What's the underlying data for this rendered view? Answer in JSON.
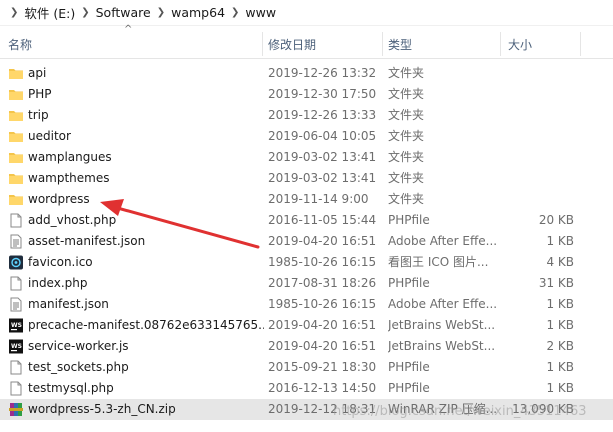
{
  "breadcrumb": [
    "软件 (E:)",
    "Software",
    "wamp64",
    "www"
  ],
  "columns": {
    "name": "名称",
    "date": "修改日期",
    "type": "类型",
    "size": "大小"
  },
  "files": [
    {
      "name": "api",
      "date": "2019-12-26 13:32",
      "type": "文件夹",
      "size": "",
      "icon": "folder-icon"
    },
    {
      "name": "PHP",
      "date": "2019-12-30 17:50",
      "type": "文件夹",
      "size": "",
      "icon": "folder-icon"
    },
    {
      "name": "trip",
      "date": "2019-12-26 13:33",
      "type": "文件夹",
      "size": "",
      "icon": "folder-icon"
    },
    {
      "name": "ueditor",
      "date": "2019-06-04 10:05",
      "type": "文件夹",
      "size": "",
      "icon": "folder-icon"
    },
    {
      "name": "wamplangues",
      "date": "2019-03-02 13:41",
      "type": "文件夹",
      "size": "",
      "icon": "folder-icon"
    },
    {
      "name": "wampthemes",
      "date": "2019-03-02 13:41",
      "type": "文件夹",
      "size": "",
      "icon": "folder-icon"
    },
    {
      "name": "wordpress",
      "date": "2019-11-14 9:00",
      "type": "文件夹",
      "size": "",
      "icon": "folder-icon"
    },
    {
      "name": "add_vhost.php",
      "date": "2016-11-05 15:44",
      "type": "PHPfile",
      "size": "20 KB",
      "icon": "file-icon"
    },
    {
      "name": "asset-manifest.json",
      "date": "2019-04-20 16:51",
      "type": "Adobe After Effe...",
      "size": "1 KB",
      "icon": "json-file-icon"
    },
    {
      "name": "favicon.ico",
      "date": "1985-10-26 16:15",
      "type": "看图王 ICO 图片...",
      "size": "4 KB",
      "icon": "ico-file-icon"
    },
    {
      "name": "index.php",
      "date": "2017-08-31 18:26",
      "type": "PHPfile",
      "size": "31 KB",
      "icon": "file-icon"
    },
    {
      "name": "manifest.json",
      "date": "1985-10-26 16:15",
      "type": "Adobe After Effe...",
      "size": "1 KB",
      "icon": "json-file-icon"
    },
    {
      "name": "precache-manifest.08762e633145765...",
      "date": "2019-04-20 16:51",
      "type": "JetBrains WebSt...",
      "size": "1 KB",
      "icon": "webstorm-file-icon"
    },
    {
      "name": "service-worker.js",
      "date": "2019-04-20 16:51",
      "type": "JetBrains WebSt...",
      "size": "2 KB",
      "icon": "webstorm-file-icon"
    },
    {
      "name": "test_sockets.php",
      "date": "2015-09-21 18:30",
      "type": "PHPfile",
      "size": "1 KB",
      "icon": "file-icon"
    },
    {
      "name": "testmysql.php",
      "date": "2016-12-13 14:50",
      "type": "PHPfile",
      "size": "1 KB",
      "icon": "file-icon"
    },
    {
      "name": "wordpress-5.3-zh_CN.zip",
      "date": "2019-12-12 18:31",
      "type": "WinRAR ZIP 压缩...",
      "size": "13,090 KB",
      "icon": "winrar-archive-icon"
    }
  ],
  "selected_index": 16,
  "watermark": "https://blog.csdn.net/weixin_43511463",
  "colors": {
    "folder": "#f4c54b",
    "arrow": "#e03131",
    "selection": "#e6e6e6",
    "header_text": "#4c607a"
  }
}
